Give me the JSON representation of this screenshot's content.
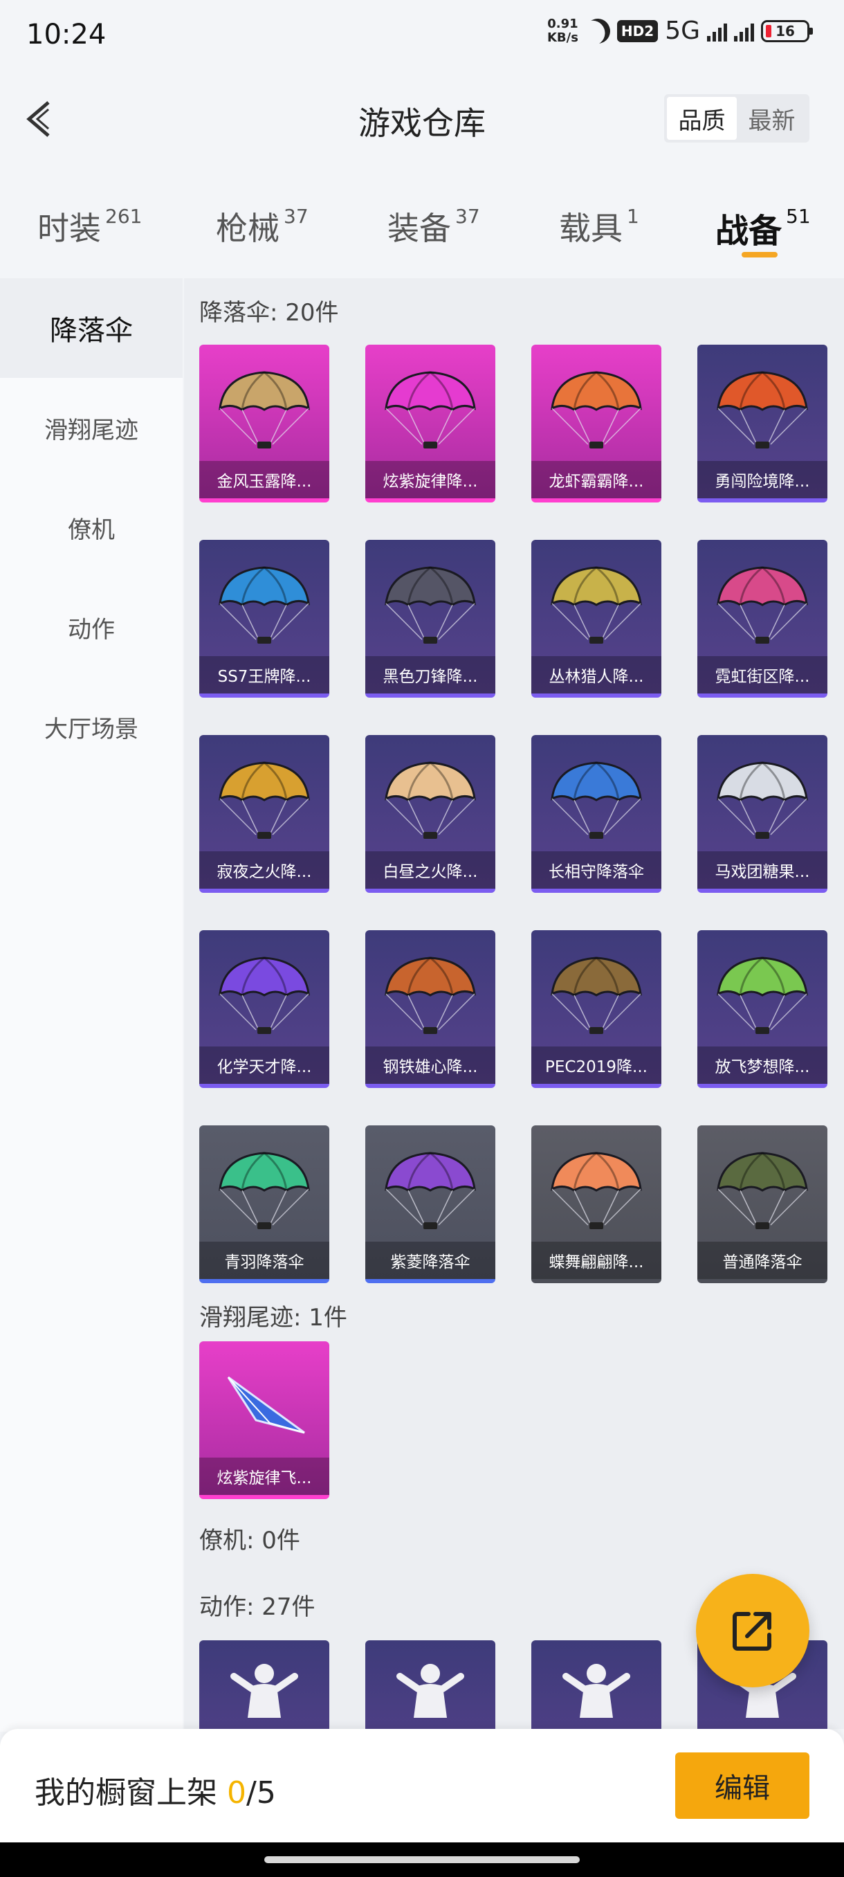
{
  "status": {
    "time": "10:24",
    "speed_top": "0.91",
    "speed_unit": "KB/s",
    "hd": "HD2",
    "network": "5G",
    "battery": "16"
  },
  "header": {
    "title": "游戏仓库",
    "sort_quality": "品质",
    "sort_latest": "最新"
  },
  "tabs": [
    {
      "label": "时装",
      "count": "261"
    },
    {
      "label": "枪械",
      "count": "37"
    },
    {
      "label": "装备",
      "count": "37"
    },
    {
      "label": "载具",
      "count": "1"
    },
    {
      "label": "战备",
      "count": "51"
    }
  ],
  "sidebar": {
    "items": [
      "降落伞",
      "滑翔尾迹",
      "僚机",
      "动作",
      "大厅场景"
    ]
  },
  "sections": {
    "parachute": {
      "title": "降落伞: 20件",
      "items": [
        {
          "name": "金风玉露降...",
          "tier": "pink",
          "color": "#c9a56a"
        },
        {
          "name": "炫紫旋律降...",
          "tier": "pink",
          "color": "#e53bd0"
        },
        {
          "name": "龙虾霸霸降...",
          "tier": "pink",
          "color": "#e8743a"
        },
        {
          "name": "勇闯险境降...",
          "tier": "purple",
          "color": "#e0582a"
        },
        {
          "name": "SS7王牌降...",
          "tier": "purple",
          "color": "#2f8ed8"
        },
        {
          "name": "黑色刀锋降...",
          "tier": "purple",
          "color": "#555566"
        },
        {
          "name": "丛林猎人降...",
          "tier": "purple",
          "color": "#c8b24a"
        },
        {
          "name": "霓虹街区降...",
          "tier": "purple",
          "color": "#d84a8a"
        },
        {
          "name": "寂夜之火降...",
          "tier": "purple",
          "color": "#d8a030"
        },
        {
          "name": "白昼之火降...",
          "tier": "purple",
          "color": "#e8c090"
        },
        {
          "name": "长相守降落伞",
          "tier": "purple",
          "color": "#3a7ad8"
        },
        {
          "name": "马戏团糖果...",
          "tier": "purple",
          "color": "#d8dce4"
        },
        {
          "name": "化学天才降...",
          "tier": "purple",
          "color": "#7a4ae0"
        },
        {
          "name": "钢铁雄心降...",
          "tier": "purple",
          "color": "#c8642e"
        },
        {
          "name": "PEC2019降...",
          "tier": "purple",
          "color": "#8a6a3a"
        },
        {
          "name": "放飞梦想降...",
          "tier": "purple",
          "color": "#7ac850"
        },
        {
          "name": "青羽降落伞",
          "tier": "blue",
          "color": "#3ac08a"
        },
        {
          "name": "紫菱降落伞",
          "tier": "blue",
          "color": "#8a4ad0"
        },
        {
          "name": "蝶舞翩翩降...",
          "tier": "gray",
          "color": "#f08a5a"
        },
        {
          "name": "普通降落伞",
          "tier": "gray",
          "color": "#5a6a40"
        }
      ]
    },
    "trail": {
      "title": "滑翔尾迹: 1件",
      "items": [
        {
          "name": "炫紫旋律飞...",
          "tier": "pink",
          "color": "#3a6ae0"
        }
      ]
    },
    "wingman": {
      "title": "僚机: 0件"
    },
    "emote": {
      "title": "动作: 27件",
      "items": [
        {},
        {},
        {},
        {}
      ]
    }
  },
  "bottom": {
    "label": "我的橱窗上架 ",
    "current": "0",
    "total": "/5",
    "edit": "编辑"
  }
}
